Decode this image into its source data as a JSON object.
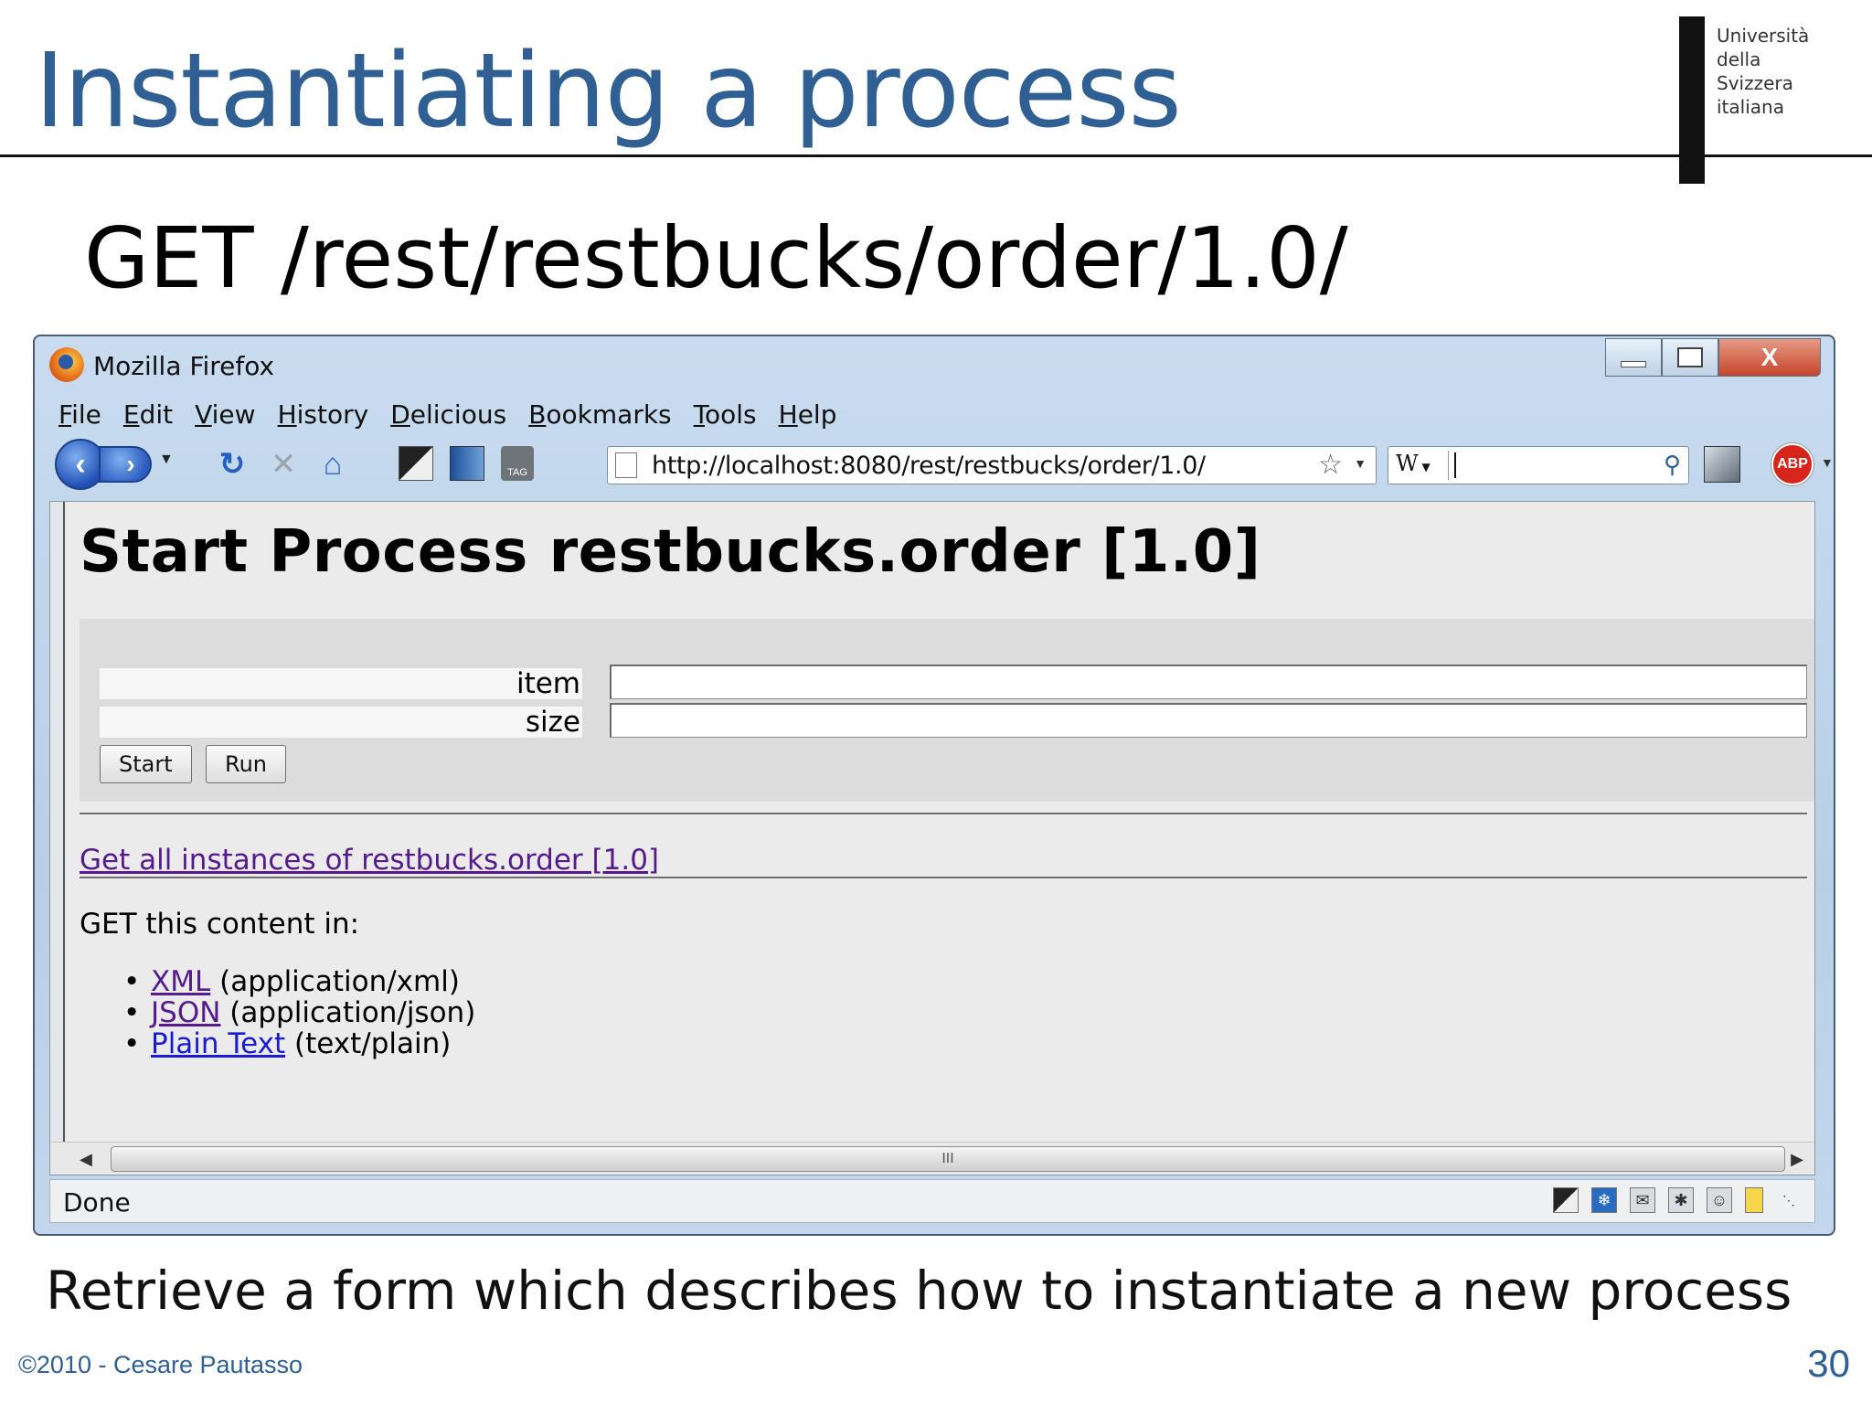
{
  "slide": {
    "title": "Instantiating a process",
    "logo_lines": [
      "Università",
      "della",
      "Svizzera",
      "italiana"
    ],
    "request_line": "GET /rest/restbucks/order/1.0/",
    "caption": "Retrieve a form which describes how to instantiate a new process",
    "footer_left": "©2010 - Cesare Pautasso",
    "page_number": "30"
  },
  "browser": {
    "window_title": "Mozilla Firefox",
    "window_buttons": {
      "close": "X"
    },
    "menu": [
      "File",
      "Edit",
      "View",
      "History",
      "Delicious",
      "Bookmarks",
      "Tools",
      "Help"
    ],
    "url": "http://localhost:8080/rest/restbucks/order/1.0/",
    "search_engine": "W",
    "toolbar_icons": [
      "back-icon",
      "forward-icon",
      "reload-icon",
      "stop-icon",
      "home-icon",
      "delicious-icon",
      "bookmark-icon",
      "tag-icon",
      "bookmark-star-icon",
      "search-icon",
      "window-icon",
      "adblock-icon"
    ],
    "tag_label": "TAG",
    "abp_label": "ABP",
    "scroll_grip": "III",
    "status": "Done"
  },
  "page": {
    "heading": "Start Process restbucks.order [1.0]",
    "fields": [
      {
        "label": "item",
        "value": ""
      },
      {
        "label": "size",
        "value": ""
      }
    ],
    "buttons": {
      "start": "Start",
      "run": "Run"
    },
    "instances_link": "Get all instances of restbucks.order [1.0]",
    "get_label": "GET this content in:",
    "formats": [
      {
        "link": "XML",
        "type": "(application/xml)"
      },
      {
        "link": "JSON",
        "type": "(application/json)"
      },
      {
        "link": "Plain Text",
        "type": "(text/plain)"
      }
    ]
  },
  "colors": {
    "title_blue": "#2f5f93",
    "link_visited": "#551a8b",
    "link_unvisited": "#1a1ad0"
  }
}
